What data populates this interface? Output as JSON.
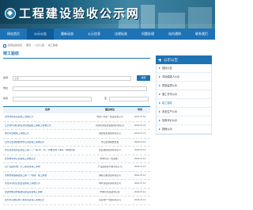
{
  "site": {
    "title": "工程建设验收公示网"
  },
  "nav": {
    "items": [
      {
        "label": "网站首页",
        "active": false
      },
      {
        "label": "公示公告",
        "active": true
      },
      {
        "label": "最新动态",
        "active": false
      },
      {
        "label": "公示信息",
        "active": false
      },
      {
        "label": "法规标准",
        "active": false
      },
      {
        "label": "问题处理",
        "active": false
      },
      {
        "label": "站内通知",
        "active": false
      },
      {
        "label": "联系我们",
        "active": false
      }
    ]
  },
  "breadcrumb": {
    "items": [
      "您现在的位置",
      "首页",
      "公示公告",
      "竣工验收"
    ]
  },
  "section": {
    "title": "竣工验收"
  },
  "form": {
    "name_label": "名称",
    "name_value": "全部",
    "search_label": "搜索",
    "unit_label": "地址",
    "date_label": "时间",
    "to_label": "至",
    "date_from": "",
    "date_to": ""
  },
  "table": {
    "headers": {
      "name": "名称",
      "unit": "建设单位",
      "date": "时间"
    },
    "rows": [
      {
        "name": "新市场住宅项目竣工验收公示",
        "unit": "中建八局第一建设有限公司",
        "date": "2023-07-15"
      },
      {
        "name": "江苏省同洲高新区某科技园区工程竣工验收公示",
        "unit": "同洲高新区建设集团有限公司",
        "date": "2023-07-15"
      },
      {
        "name": "教育综合楼竣工验收公示",
        "unit": "城建投资发展有限公司",
        "date": "2023-07-15"
      },
      {
        "name": "某市卫生健康服务中心项目竣工验收公示",
        "unit": "市卫生健康委员会",
        "date": "2023-07-15"
      },
      {
        "name": "住宅及配套商业建设工程——一期 3#、4#、5#楼及地下车库（验收阶段）",
        "unit": "置业发展集团有限公司",
        "date": "2023-07-15"
      },
      {
        "name": "文化体育中心项目竣工验收公示",
        "unit": "市体育局（筹建处）",
        "date": "2023-07-14"
      },
      {
        "name": "某产业园标准厂房二期项目竣工验收",
        "unit": "产业园投资开发有限公司",
        "date": "2023-07-14"
      },
      {
        "name": "某城市快速路改造工程（一标段）竣工验收",
        "unit": "城投公路建设有限公司",
        "date": "2023-07-14"
      },
      {
        "name": "安置房项目及配套设施竣工验收公示",
        "unit": "城乡建设投资有限公司",
        "date": "2023-07-14"
      },
      {
        "name": "新建学校及附属用房建设项目竣工验收",
        "unit": "市教育局基建办公室",
        "date": "2023-07-14"
      },
      {
        "name": "商务办公楼及地下车库项目竣工验收公示",
        "unit": "商业地产开发有限公司",
        "date": "2023-07-13"
      }
    ]
  },
  "sidebar": {
    "title": "公示公告",
    "items": [
      {
        "label": "招标公告",
        "active": false
      },
      {
        "label": "中标候选人公示",
        "active": false
      },
      {
        "label": "质量监督公示",
        "active": false
      },
      {
        "label": "施工许可公示",
        "active": false
      },
      {
        "label": "竣工验收",
        "active": true
      },
      {
        "label": "安全生产公示",
        "active": false
      },
      {
        "label": "信用评价公示",
        "active": false
      },
      {
        "label": "其他公示",
        "active": false
      }
    ]
  },
  "colors": {
    "primary": "#1e73b5",
    "banner_dark": "#0f3f58",
    "link": "#1e5e9a"
  }
}
